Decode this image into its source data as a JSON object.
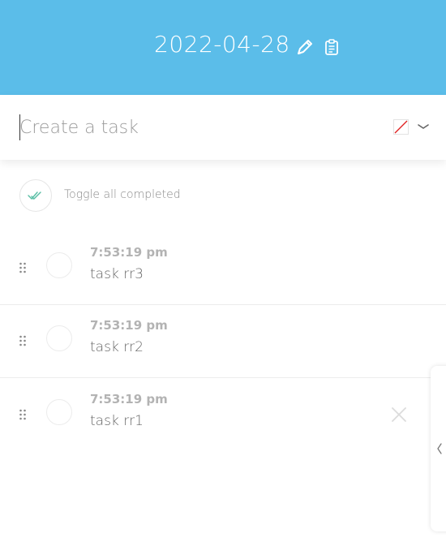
{
  "header": {
    "date": "2022-04-28",
    "background_color": "#5bbde9",
    "icons": [
      "pencil-icon",
      "clipboard-icon"
    ]
  },
  "create": {
    "placeholder": "Create a task",
    "value": "",
    "color_swatch_icon": "no-color-swatch-icon",
    "dropdown_icon": "chevron-down-icon"
  },
  "toggle_all": {
    "label": "Toggle all completed",
    "icon": "double-check-icon",
    "icon_color": "#5bbfa6"
  },
  "tasks": [
    {
      "time": "7:53:19 pm",
      "title": "task rr3"
    },
    {
      "time": "7:53:19 pm",
      "title": "task rr2"
    },
    {
      "time": "7:53:19 pm",
      "title": "task rr1"
    }
  ],
  "side_panel": {
    "icon": "chevron-left-icon"
  }
}
